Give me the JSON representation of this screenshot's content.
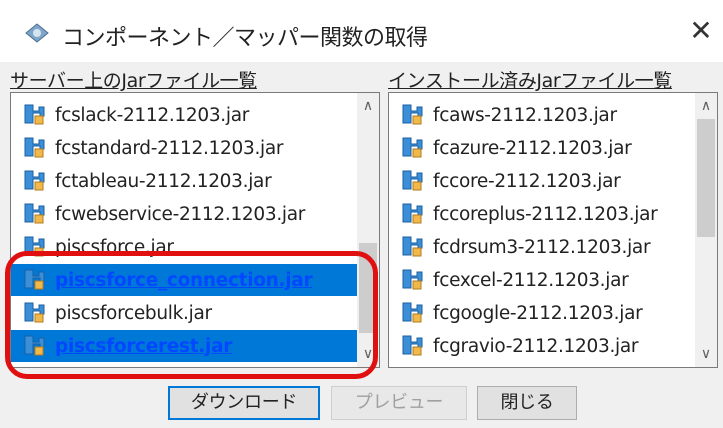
{
  "window": {
    "title": "コンポーネント／マッパー関数の取得",
    "close_glyph": "✕"
  },
  "server_panel": {
    "label": "サーバー上のJarファイル一覧",
    "items": [
      {
        "name": "fcslack-2112.1203.jar",
        "selected": false
      },
      {
        "name": "fcstandard-2112.1203.jar",
        "selected": false
      },
      {
        "name": "fctableau-2112.1203.jar",
        "selected": false
      },
      {
        "name": "fcwebservice-2112.1203.jar",
        "selected": false
      },
      {
        "name": "piscsforce.jar",
        "selected": false
      },
      {
        "name": "piscsforce_connection.jar",
        "selected": true
      },
      {
        "name": "piscsforcebulk.jar",
        "selected": false
      },
      {
        "name": "piscsforcerest.jar",
        "selected": true
      }
    ]
  },
  "installed_panel": {
    "label": "インストール済みJarファイル一覧",
    "items": [
      {
        "name": "fcaws-2112.1203.jar"
      },
      {
        "name": "fcazure-2112.1203.jar"
      },
      {
        "name": "fccore-2112.1203.jar"
      },
      {
        "name": "fccoreplus-2112.1203.jar"
      },
      {
        "name": "fcdrsum3-2112.1203.jar"
      },
      {
        "name": "fcexcel-2112.1203.jar"
      },
      {
        "name": "fcgoogle-2112.1203.jar"
      },
      {
        "name": "fcgravio-2112.1203.jar"
      }
    ]
  },
  "buttons": {
    "download": "ダウンロード",
    "preview": "プレビュー",
    "close": "閉じる"
  },
  "colors": {
    "selection": "#0078d7",
    "highlight_box": "#e01010"
  }
}
